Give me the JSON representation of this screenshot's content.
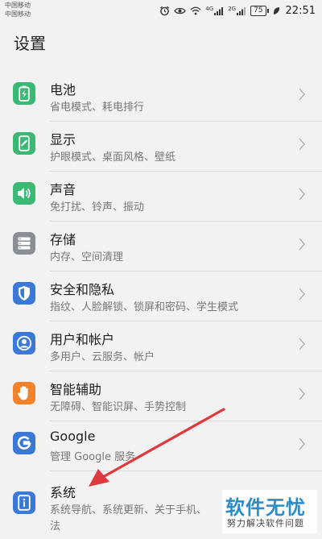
{
  "statusbar": {
    "carrier1": "中国移动",
    "carrier2": "中国移动",
    "net1": "4G",
    "net2": "2G",
    "battery": "75",
    "time": "22:51"
  },
  "page_title": "设置",
  "items": [
    {
      "title": "电池",
      "subtitle": "省电模式、耗电排行",
      "icon": "battery-icon",
      "color": "#3bb873"
    },
    {
      "title": "显示",
      "subtitle": "护眼模式、桌面风格、壁纸",
      "icon": "display-icon",
      "color": "#3bb873"
    },
    {
      "title": "声音",
      "subtitle": "免打扰、铃声、振动",
      "icon": "speaker-icon",
      "color": "#3bb873"
    },
    {
      "title": "存储",
      "subtitle": "内存、空间清理",
      "icon": "storage-icon",
      "color": "#8a8f96"
    },
    {
      "title": "安全和隐私",
      "subtitle": "指纹、人脸解锁、锁屏和密码、学生模式",
      "icon": "shield-icon",
      "color": "#3a79d8"
    },
    {
      "title": "用户和帐户",
      "subtitle": "多用户、云服务、帐户",
      "icon": "user-icon",
      "color": "#3a79d8"
    },
    {
      "title": "智能辅助",
      "subtitle": "无障碍、智能识屏、手势控制",
      "icon": "hand-icon",
      "color": "#f0822c"
    },
    {
      "title": "Google",
      "subtitle": "管理 Google 服务",
      "icon": "google-icon",
      "color": "#3a79d8"
    },
    {
      "title": "系统",
      "subtitle": "系统导航、系统更新、关于手机、",
      "subtitle2": "法",
      "icon": "info-icon",
      "color": "#3a79d8"
    }
  ],
  "watermark": {
    "main": "软件无忧",
    "sub": "努力解决软件问题"
  },
  "annotation": {
    "color": "#e0393d"
  }
}
